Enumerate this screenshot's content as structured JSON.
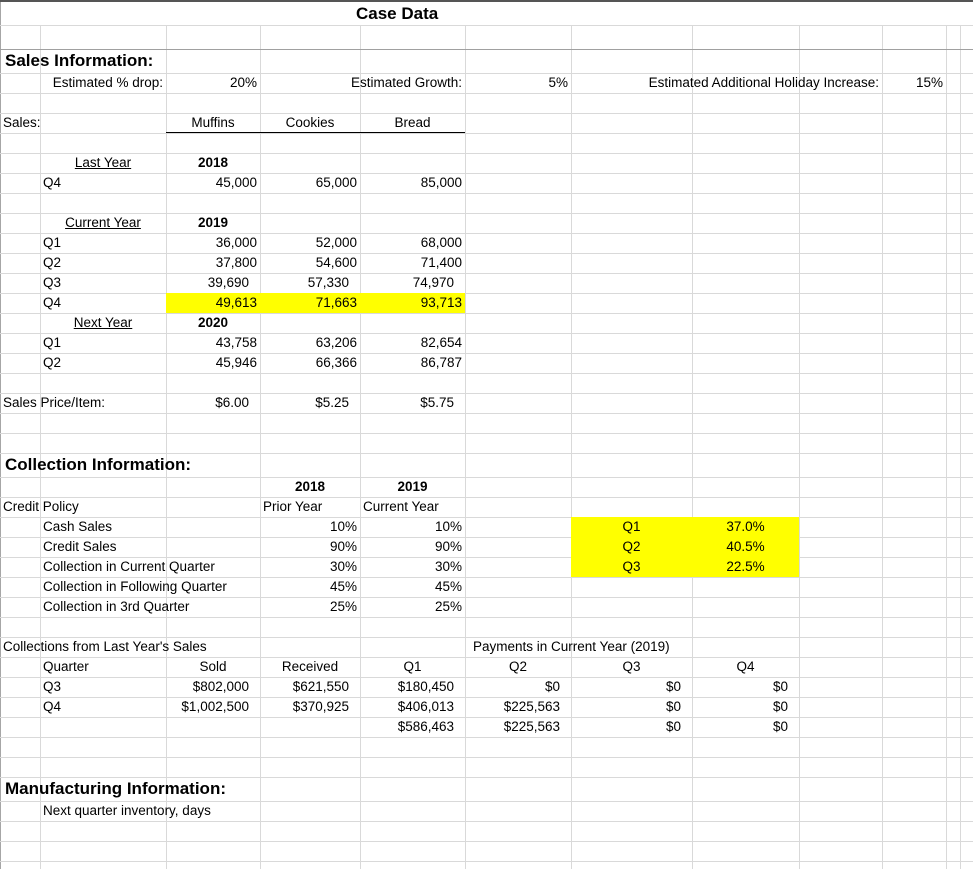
{
  "title": "Case Data",
  "sales_info": {
    "heading": "Sales Information:",
    "estimated_drop_label": "Estimated % drop:",
    "estimated_drop_value": "20%",
    "estimated_growth_label": "Estimated Growth:",
    "estimated_growth_value": "5%",
    "holiday_increase_label": "Estimated Additional Holiday Increase:",
    "holiday_increase_value": "15%"
  },
  "sales": {
    "label": "Sales:",
    "columns": [
      "Muffins",
      "Cookies",
      "Bread"
    ],
    "last_year": {
      "label": "Last Year",
      "year": "2018",
      "rows": [
        {
          "quarter": "Q4",
          "values": [
            "45,000",
            "65,000",
            "85,000"
          ]
        }
      ]
    },
    "current_year": {
      "label": "Current Year",
      "year": "2019",
      "rows": [
        {
          "quarter": "Q1",
          "values": [
            "36,000",
            "52,000",
            "68,000"
          ]
        },
        {
          "quarter": "Q2",
          "values": [
            "37,800",
            "54,600",
            "71,400"
          ]
        },
        {
          "quarter": "Q3",
          "values": [
            "39,690",
            "57,330",
            "74,970"
          ]
        },
        {
          "quarter": "Q4",
          "values": [
            "49,613",
            "71,663",
            "93,713"
          ]
        }
      ]
    },
    "next_year": {
      "label": "Next Year",
      "year": "2020",
      "rows": [
        {
          "quarter": "Q1",
          "values": [
            "43,758",
            "63,206",
            "82,654"
          ]
        },
        {
          "quarter": "Q2",
          "values": [
            "45,946",
            "66,366",
            "86,787"
          ]
        }
      ]
    },
    "price_label": "Sales Price/Item:",
    "prices": [
      "$6.00",
      "$5.25",
      "$5.75"
    ],
    "highlight_color": "#ffff00"
  },
  "collection_info": {
    "heading": "Collection Information:",
    "year_headers": [
      "2018",
      "2019"
    ],
    "period_headers": [
      "Prior Year",
      "Current Year"
    ],
    "credit_policy_label": "Credit Policy",
    "rows": [
      {
        "label": "Cash Sales",
        "values": [
          "10%",
          "10%"
        ]
      },
      {
        "label": "Credit Sales",
        "values": [
          "90%",
          "90%"
        ]
      },
      {
        "label": "Collection in Current Quarter",
        "values": [
          "30%",
          "30%"
        ]
      },
      {
        "label": "Collection in Following Quarter",
        "values": [
          "45%",
          "45%"
        ]
      },
      {
        "label": "Collection in 3rd Quarter",
        "values": [
          "25%",
          "25%"
        ]
      }
    ],
    "quarter_shares": [
      {
        "quarter": "Q1",
        "value": "37.0%"
      },
      {
        "quarter": "Q2",
        "value": "40.5%"
      },
      {
        "quarter": "Q3",
        "value": "22.5%"
      }
    ]
  },
  "last_year_collections": {
    "heading": "Collections from Last Year's Sales",
    "payments_heading": "Payments in Current Year (2019)",
    "columns": [
      "Quarter",
      "Sold",
      "Received",
      "Q1",
      "Q2",
      "Q3",
      "Q4"
    ],
    "rows": [
      {
        "quarter": "Q3",
        "sold": "$802,000",
        "received": "$621,550",
        "q1": "$180,450",
        "q2": "$0",
        "q3": "$0",
        "q4": "$0"
      },
      {
        "quarter": "Q4",
        "sold": "$1,002,500",
        "received": "$370,925",
        "q1": "$406,013",
        "q2": "$225,563",
        "q3": "$0",
        "q4": "$0"
      }
    ],
    "totals": {
      "q1": "$586,463",
      "q2": "$225,563",
      "q3": "$0",
      "q4": "$0"
    }
  },
  "manufacturing_info": {
    "heading": "Manufacturing Information:",
    "inventory_label": "Next quarter inventory, days"
  }
}
